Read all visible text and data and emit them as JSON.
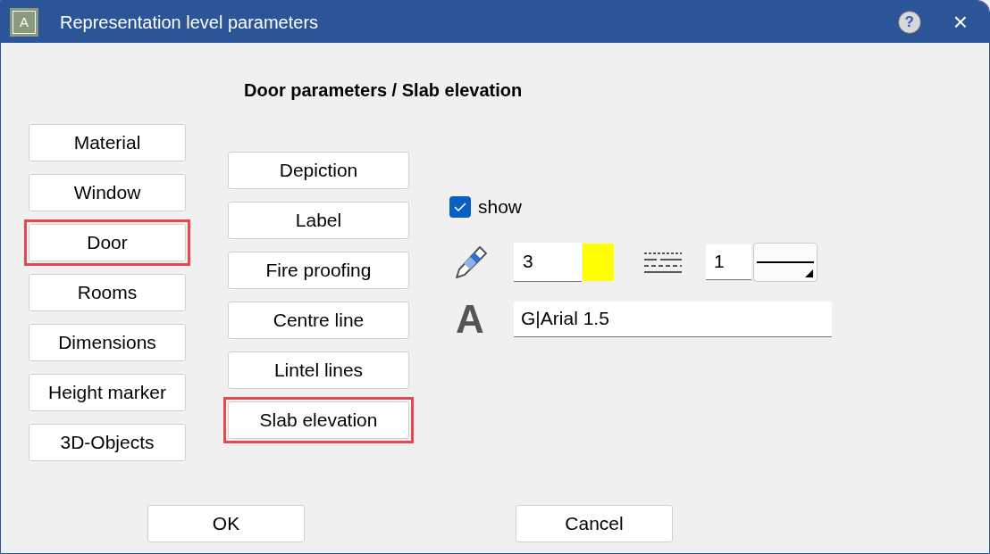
{
  "window": {
    "icon_letter": "A",
    "title": "Representation level parameters",
    "help": "?",
    "close": "×"
  },
  "heading": "Door parameters / Slab elevation",
  "categories": [
    {
      "label": "Material",
      "selected": false
    },
    {
      "label": "Window",
      "selected": false
    },
    {
      "label": "Door",
      "selected": true
    },
    {
      "label": "Rooms",
      "selected": false
    },
    {
      "label": "Dimensions",
      "selected": false
    },
    {
      "label": "Height marker",
      "selected": false
    },
    {
      "label": "3D-Objects",
      "selected": false
    }
  ],
  "subcategories": [
    {
      "label": "Depiction",
      "selected": false
    },
    {
      "label": "Label",
      "selected": false
    },
    {
      "label": "Fire proofing",
      "selected": false
    },
    {
      "label": "Centre line",
      "selected": false
    },
    {
      "label": "Lintel lines",
      "selected": false
    },
    {
      "label": "Slab elevation",
      "selected": true
    }
  ],
  "show": {
    "label": "show",
    "checked": true
  },
  "pen": {
    "value": "3",
    "color": "#ffff00"
  },
  "line": {
    "value": "1"
  },
  "font": {
    "symbol": "A",
    "value": "G|Arial 1.5"
  },
  "buttons": [
    "OK",
    "Cancel"
  ]
}
